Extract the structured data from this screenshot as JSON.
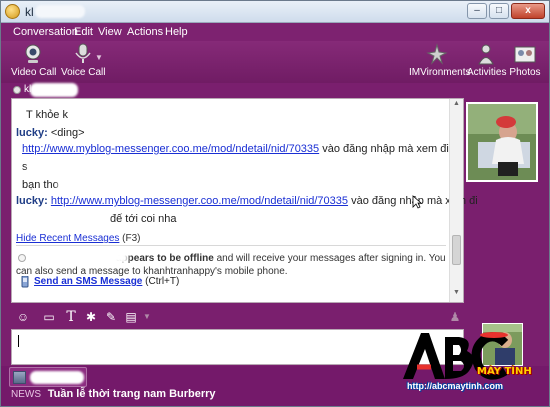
{
  "window": {
    "title": "kl",
    "controls": {
      "minimize": "–",
      "maximize": "□",
      "close": "x"
    }
  },
  "menu": [
    "Conversation",
    "Edit",
    "View",
    "Actions",
    "Help"
  ],
  "toolbar": {
    "video_call": "Video Call",
    "voice_call": "Voice Call",
    "imvironments": "IMVironments",
    "activities": "Activities",
    "photos": "Photos"
  },
  "contact_status": {
    "text": "kl"
  },
  "conversation": {
    "messages": [
      {
        "text": "T khỏe k"
      },
      {
        "sender": "lucky:",
        "text": "<ding>"
      },
      {
        "link": "http://www.myblog-messenger.coo.me/mod/ndetail/nid/70335",
        "after": "vào đăng nhập mà xem đi"
      },
      {
        "text": "s"
      },
      {
        "text": "bạn tho"
      },
      {
        "sender": "lucky:",
        "link": "http://www.myblog-messenger.coo.me/mod/ndetail/nid/70335",
        "after": "vào đăng nhập mà xem đi"
      },
      {
        "text": "đế tới coi nha"
      }
    ],
    "hide_recent": "Hide Recent Messages",
    "hide_recent_key": "(F3)",
    "offline_bold": "appears to be offline",
    "offline_rest": "and will receive your messages after signing in. You can also send a message to khanhtranhappy's mobile phone.",
    "sms_link": "Send an SMS Message",
    "sms_key": "(Ctrl+T)"
  },
  "input": {
    "value": ""
  },
  "dock": {
    "news_label": "NEWS",
    "news_headline": "Tuần lễ thời trang nam Burberry"
  },
  "watermark": {
    "brand": "MÁY TÍNH",
    "url": "http://abcmaytinh.com"
  },
  "colors": {
    "theme": "#7a1f6e",
    "link": "#1a2fd4",
    "sender": "#1f3d86"
  },
  "icons": [
    "yahoo-messenger-icon",
    "webcam-icon",
    "microphone-icon",
    "imvironments-icon",
    "activities-icon",
    "photos-icon",
    "emoticon-icon",
    "nudge-icon",
    "text-format-icon",
    "audible-icon",
    "paperclip-icon",
    "insert-icon",
    "sms-icon"
  ]
}
